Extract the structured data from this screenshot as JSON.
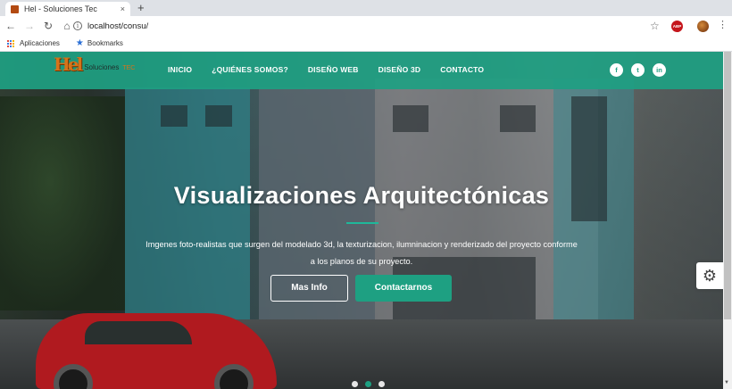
{
  "browser": {
    "tab_title": "Hel - Soluciones Tec",
    "tab_close": "×",
    "new_tab": "+",
    "url": "localhost/consu/",
    "nav": {
      "back": "←",
      "forward": "→",
      "reload": "↻",
      "home": "⌂"
    },
    "star": "☆",
    "abp_label": "ABP",
    "menu": "⋮",
    "bookmarks": {
      "apps": "Aplicaciones",
      "bookmarks": "Bookmarks"
    }
  },
  "site": {
    "logo": {
      "mark": "Hel",
      "name": "Soluciones",
      "tec": "TEC"
    },
    "nav": [
      "INICIO",
      "¿QUIÉNES SOMOS?",
      "DISEÑO WEB",
      "DISEÑO 3D",
      "CONTACTO"
    ],
    "social": {
      "facebook": "f",
      "twitter": "t",
      "linkedin": "in"
    },
    "hero": {
      "title": "Visualizaciones Arquitectónicas",
      "text_line1": "Imgenes foto-realistas que surgen del modelado 3d, la texturizacion, ilumninacion y renderizado del proyecto conforme",
      "text_line2": "a los planos de su proyecto.",
      "btn_info": "Mas Info",
      "btn_contact": "Contactarnos"
    },
    "gear_icon": "⚙",
    "carousel": {
      "count": 3,
      "active": 2
    },
    "colors": {
      "accent": "#1ea082",
      "brand_orange": "#d6731a"
    }
  }
}
